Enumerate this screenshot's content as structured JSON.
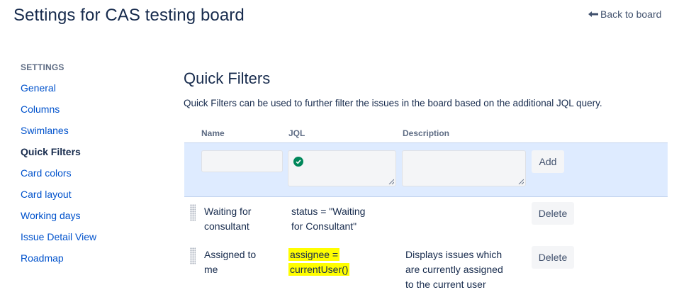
{
  "header": {
    "title": "Settings for CAS testing board",
    "back_label": "Back to board"
  },
  "sidebar": {
    "heading": "SETTINGS",
    "items": [
      {
        "label": "General",
        "active": false
      },
      {
        "label": "Columns",
        "active": false
      },
      {
        "label": "Swimlanes",
        "active": false
      },
      {
        "label": "Quick Filters",
        "active": true
      },
      {
        "label": "Card colors",
        "active": false
      },
      {
        "label": "Card layout",
        "active": false
      },
      {
        "label": "Working days",
        "active": false
      },
      {
        "label": "Issue Detail View",
        "active": false
      },
      {
        "label": "Roadmap",
        "active": false
      }
    ]
  },
  "main": {
    "title": "Quick Filters",
    "description": "Quick Filters can be used to further filter the issues in the board based on the additional JQL query.",
    "columns": {
      "name": "Name",
      "jql": "JQL",
      "description": "Description"
    },
    "new_filter": {
      "name_value": "",
      "jql_value": "",
      "description_value": "",
      "jql_status_icon": "check-circle-icon",
      "add_label": "Add"
    },
    "filters": [
      {
        "name_lines": [
          "Waiting for",
          "consultant"
        ],
        "jql_lines": [
          "status = \"Waiting",
          "for Consultant\""
        ],
        "description_lines": [],
        "highlighted": false,
        "delete_label": "Delete"
      },
      {
        "name_lines": [
          "Assigned to",
          "me"
        ],
        "jql_lines": [
          "assignee =",
          "currentUser()"
        ],
        "description_lines": [
          "Displays issues which",
          "are currently assigned",
          "to the current user"
        ],
        "highlighted": true,
        "delete_label": "Delete"
      }
    ]
  },
  "colors": {
    "link": "#0052cc",
    "add_row_bg": "#deebff",
    "valid": "#00875a",
    "highlight": "#fffe00"
  }
}
